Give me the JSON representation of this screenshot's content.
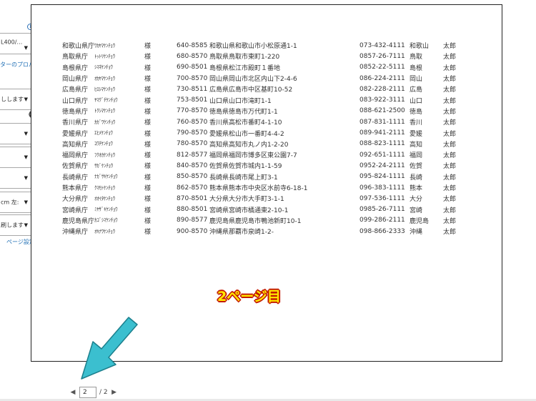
{
  "left_panel": {
    "printer_value": "L400/…",
    "printer_properties_link": "ターのプロパティ",
    "setting_1": "しします",
    "setting_6": "cm 左:",
    "setting_7": "刷します",
    "page_setup_link": "ページ設定"
  },
  "preview": {
    "page_label": "2ページ目",
    "rows": [
      {
        "pref": "和歌山県庁",
        "kana": "ﾜｶﾔﾏｹﾝﾁｮｳ",
        "sama": "様",
        "zip": "640-8585",
        "address": "和歌山県和歌山市小松原通1-1",
        "tel": "073-432-4111",
        "short": "和歌山",
        "name": "太郎"
      },
      {
        "pref": "鳥取県庁",
        "kana": "ﾄｯﾄﾘｹﾝﾁｮｳ",
        "sama": "様",
        "zip": "680-8570",
        "address": "鳥取県鳥取市東町1-220",
        "tel": "0857-26-7111",
        "short": "鳥取",
        "name": "太郎"
      },
      {
        "pref": "島根県庁",
        "kana": "ｼﾏﾈｹﾝﾁｮｳ",
        "sama": "様",
        "zip": "690-8501",
        "address": "島根県松江市殿町１番地",
        "tel": "0852-22-5111",
        "short": "島根",
        "name": "太郎"
      },
      {
        "pref": "岡山県庁",
        "kana": "ｵｶﾔﾏｹﾝﾁｮｳ",
        "sama": "様",
        "zip": "700-8570",
        "address": "岡山県岡山市北区内山下2-4-6",
        "tel": "086-224-2111",
        "short": "岡山",
        "name": "太郎"
      },
      {
        "pref": "広島県庁",
        "kana": "ﾋﾛｼﾏｹﾝﾁｮｳ",
        "sama": "様",
        "zip": "730-8511",
        "address": "広島県広島市中区基町10-52",
        "tel": "082-228-2111",
        "short": "広島",
        "name": "太郎"
      },
      {
        "pref": "山口県庁",
        "kana": "ﾔﾏｸﾞﾁｹﾝﾁｮｳ",
        "sama": "様",
        "zip": "753-8501",
        "address": "山口県山口市滝町1-1",
        "tel": "083-922-3111",
        "short": "山口",
        "name": "太郎"
      },
      {
        "pref": "徳島県庁",
        "kana": "ﾄｸｼﾏｹﾝﾁｮｳ",
        "sama": "様",
        "zip": "770-8570",
        "address": "徳島県徳島市万代町1-1",
        "tel": "088-621-2500",
        "short": "徳島",
        "name": "太郎"
      },
      {
        "pref": "香川県庁",
        "kana": "ｶｶﾞﾜｹﾝﾁｮｳ",
        "sama": "様",
        "zip": "760-8570",
        "address": "香川県高松市番町4-1-10",
        "tel": "087-831-1111",
        "short": "香川",
        "name": "太郎"
      },
      {
        "pref": "愛媛県庁",
        "kana": "ｴﾋﾒｹﾝﾁｮｳ",
        "sama": "様",
        "zip": "790-8570",
        "address": "愛媛県松山市一番町4-4-2",
        "tel": "089-941-2111",
        "short": "愛媛",
        "name": "太郎"
      },
      {
        "pref": "高知県庁",
        "kana": "ｺｳﾁｹﾝﾁｮｳ",
        "sama": "様",
        "zip": "780-8570",
        "address": "高知県高知市丸ノ内1-2-20",
        "tel": "088-823-1111",
        "short": "高知",
        "name": "太郎"
      },
      {
        "pref": "福岡県庁",
        "kana": "ﾌｸｵｶｹﾝﾁｮｳ",
        "sama": "様",
        "zip": "812-8577",
        "address": "福岡県福岡市博多区東公園7-7",
        "tel": "092-651-1111",
        "short": "福岡",
        "name": "太郎"
      },
      {
        "pref": "佐賀県庁",
        "kana": "ｻｶﾞｹﾝﾁｮｳ",
        "sama": "様",
        "zip": "840-8570",
        "address": "佐賀県佐賀市城内1-1-59",
        "tel": "0952-24-2111",
        "short": "佐賀",
        "name": "太郎"
      },
      {
        "pref": "長崎県庁",
        "kana": "ﾅｶﾞｻｷｹﾝﾁｮｳ",
        "sama": "様",
        "zip": "850-8570",
        "address": "長崎県長崎市尾上町3-1",
        "tel": "095-824-1111",
        "short": "長崎",
        "name": "太郎"
      },
      {
        "pref": "熊本県庁",
        "kana": "ｸﾏﾓﾄｹﾝﾁｮｳ",
        "sama": "様",
        "zip": "862-8570",
        "address": "熊本県熊本市中央区水前寺6-18-1",
        "tel": "096-383-1111",
        "short": "熊本",
        "name": "太郎"
      },
      {
        "pref": "大分県庁",
        "kana": "ｵｵｲﾀｹﾝﾁｮｳ",
        "sama": "様",
        "zip": "870-8501",
        "address": "大分県大分市大手町3-1-1",
        "tel": "097-536-1111",
        "short": "大分",
        "name": "太郎"
      },
      {
        "pref": "宮崎県庁",
        "kana": "ﾐﾔｻﾞｷｹﾝﾁｮｳ",
        "sama": "様",
        "zip": "880-8501",
        "address": "宮崎県宮崎市橘通東2-10-1",
        "tel": "0985-26-7111",
        "short": "宮崎",
        "name": "太郎"
      },
      {
        "pref": "鹿児島県庁",
        "kana": "ｶｺﾞｼﾏｹﾝﾁｮｳ",
        "sama": "様",
        "zip": "890-8577",
        "address": "鹿児島県鹿児島市鴨池新町10-1",
        "tel": "099-286-2111",
        "short": "鹿児島",
        "name": "太郎"
      },
      {
        "pref": "沖縄県庁",
        "kana": "ｵｷﾅﾜｹﾝﾁｮｳ",
        "sama": "様",
        "zip": "900-8570",
        "address": "沖縄県那覇市泉崎1-2-",
        "tel": "098-866-2333",
        "short": "沖縄",
        "name": "太郎"
      }
    ]
  },
  "page_nav": {
    "current_page": "2",
    "total_pages": "/ 2"
  },
  "colors": {
    "arrow": "#3bbfcf",
    "page_label_fill": "#ffe800",
    "page_label_outline": "#c41b00",
    "link": "#1f6fb5"
  }
}
